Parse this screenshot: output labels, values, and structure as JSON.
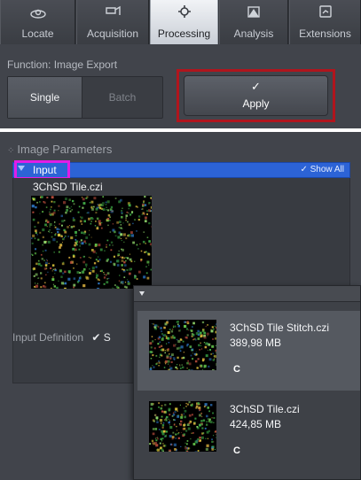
{
  "tabs": [
    {
      "label": "Locate",
      "icon": "locate-icon",
      "active": false
    },
    {
      "label": "Acquisition",
      "icon": "acquisition-icon",
      "active": false
    },
    {
      "label": "Processing",
      "icon": "processing-icon",
      "active": true
    },
    {
      "label": "Analysis",
      "icon": "analysis-icon",
      "active": false
    },
    {
      "label": "Extensions",
      "icon": "extensions-icon",
      "active": false
    }
  ],
  "function_label": "Function:  Image Export",
  "modes": {
    "single": "Single",
    "batch": "Batch",
    "selected": "Single"
  },
  "apply": {
    "check": "✓",
    "label": "Apply"
  },
  "image_parameters": {
    "header": "Image Parameters",
    "input": {
      "label": "Input",
      "show_all": "✓ Show All",
      "expanded": true
    },
    "file_title": "3ChSD Tile.czi",
    "input_definition": "Input Definition",
    "checkbox_text": "S"
  },
  "dropdown": {
    "items": [
      {
        "name": "3ChSD Tile Stitch.czi",
        "size": "389,98 MB",
        "channel": "C",
        "selected": true
      },
      {
        "name": "3ChSD Tile.czi",
        "size": "424,85 MB",
        "channel": "C",
        "selected": false
      }
    ]
  },
  "colors": {
    "panel_bg": "#41444b",
    "input_bar": "#2c63d6",
    "apply_highlight": "#b0151d",
    "input_highlight": "#e11de6"
  }
}
